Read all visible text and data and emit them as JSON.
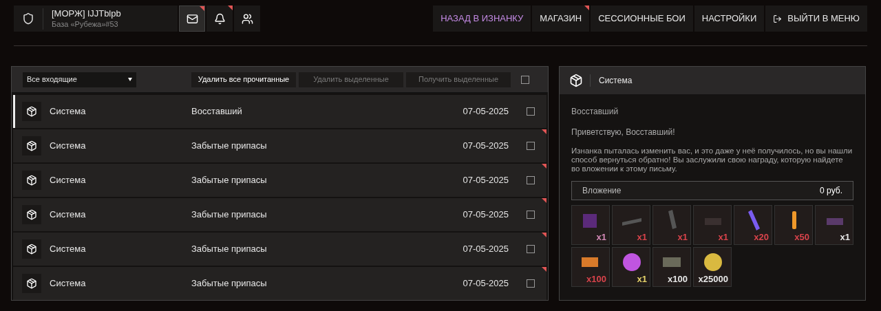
{
  "profile": {
    "name": "[МОРЖ] lJJTblpb",
    "subtitle": "База «Рубежа»#53"
  },
  "icon_buttons": [
    {
      "kind": "mail",
      "selected": true,
      "unread": true
    },
    {
      "kind": "bell",
      "selected": false,
      "unread": true
    },
    {
      "kind": "friends",
      "selected": false,
      "unread": false
    }
  ],
  "nav": [
    {
      "label": "НАЗАД В ИЗНАНКУ",
      "highlighted": true,
      "unread": false,
      "kind": "text"
    },
    {
      "label": "МАГАЗИН",
      "highlighted": false,
      "unread": true,
      "kind": "text"
    },
    {
      "label": "СЕССИОННЫЕ БОИ",
      "highlighted": false,
      "unread": false,
      "kind": "text"
    },
    {
      "label": "НАСТРОЙКИ",
      "highlighted": false,
      "unread": false,
      "kind": "text"
    },
    {
      "label": "ВЫЙТИ В МЕНЮ",
      "highlighted": false,
      "unread": false,
      "kind": "exit"
    }
  ],
  "toolbar": {
    "filter": "Все входящие",
    "buttons": [
      {
        "label": "Удалить все прочитанные",
        "disabled": false
      },
      {
        "label": "Удалить выделенные",
        "disabled": true
      },
      {
        "label": "Получить выделенные",
        "disabled": true
      }
    ],
    "select_all": false
  },
  "messages": [
    {
      "sender": "Система",
      "subject": "Восставший",
      "date": "07-05-2025",
      "selected": true,
      "unread": false,
      "checked": false
    },
    {
      "sender": "Система",
      "subject": "Забытые припасы",
      "date": "07-05-2025",
      "selected": false,
      "unread": true,
      "checked": false
    },
    {
      "sender": "Система",
      "subject": "Забытые припасы",
      "date": "07-05-2025",
      "selected": false,
      "unread": true,
      "checked": false
    },
    {
      "sender": "Система",
      "subject": "Забытые припасы",
      "date": "07-05-2025",
      "selected": false,
      "unread": true,
      "checked": false
    },
    {
      "sender": "Система",
      "subject": "Забытые припасы",
      "date": "07-05-2025",
      "selected": false,
      "unread": true,
      "checked": false
    },
    {
      "sender": "Система",
      "subject": "Забытые припасы",
      "date": "07-05-2025",
      "selected": false,
      "unread": true,
      "checked": false
    }
  ],
  "letter": {
    "sender": "Система",
    "title": "Восставший",
    "greeting": "Приветствую, Восставший!",
    "body": "Изнанка пыталась изменить вас, и это даже у неё получилось, но вы нашли способ вернуться обратно! Вы заслужили свою награду, которую найдете во вложении к этому письму.",
    "attachment": {
      "label": "Вложение",
      "price": "0 руб."
    },
    "items": [
      {
        "kind": "cubes",
        "count": "x1",
        "color": "#d58ab8"
      },
      {
        "kind": "tube",
        "count": "x1",
        "color": "#d9434b"
      },
      {
        "kind": "grip",
        "count": "x1",
        "color": "#d9434b"
      },
      {
        "kind": "scope",
        "count": "x1",
        "color": "#d9434b"
      },
      {
        "kind": "glowstick",
        "count": "x20",
        "color": "#d9434b"
      },
      {
        "kind": "syringe",
        "count": "x50",
        "color": "#d9434b"
      },
      {
        "kind": "part",
        "count": "x1",
        "color": "#e6e6e6"
      },
      {
        "kind": "scrap",
        "count": "x100",
        "color": "#d9434b"
      },
      {
        "kind": "purple-coin",
        "count": "x1",
        "color": "#e6d36a"
      },
      {
        "kind": "box",
        "count": "x100",
        "color": "#e6e6e6"
      },
      {
        "kind": "gold-coin",
        "count": "x25000",
        "color": "#e6e6e6"
      }
    ]
  }
}
